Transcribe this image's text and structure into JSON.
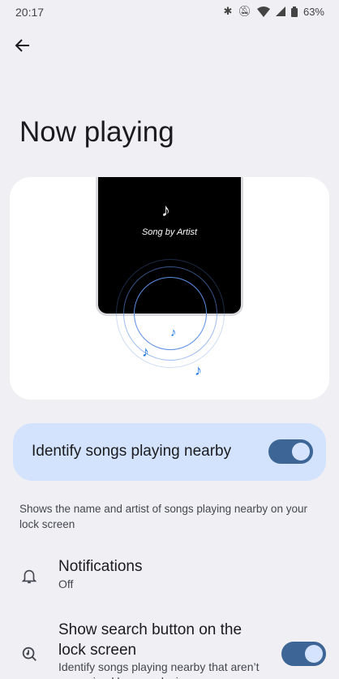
{
  "status": {
    "time": "20:17",
    "battery": "63%",
    "icons": [
      "bluetooth-icon",
      "notifications-off-icon",
      "wifi-icon",
      "signal-icon",
      "battery-icon"
    ]
  },
  "page": {
    "title": "Now playing"
  },
  "illustration": {
    "song_text": "Song by Artist"
  },
  "main_toggle": {
    "label": "Identify songs playing nearby",
    "on": true
  },
  "description": "Shows the name and artist of songs playing nearby on your lock screen",
  "items": [
    {
      "title": "Notifications",
      "subtitle": "Off",
      "icon": "bell-icon"
    },
    {
      "title": "Show search button on the lock screen",
      "subtitle": "Identify songs playing nearby that aren’t recognized by your device",
      "icon": "music-search-icon",
      "on": true
    }
  ],
  "colors": {
    "accent": "#3d6596",
    "toggle_card": "#d3e3fd",
    "background": "#f0eff4"
  }
}
